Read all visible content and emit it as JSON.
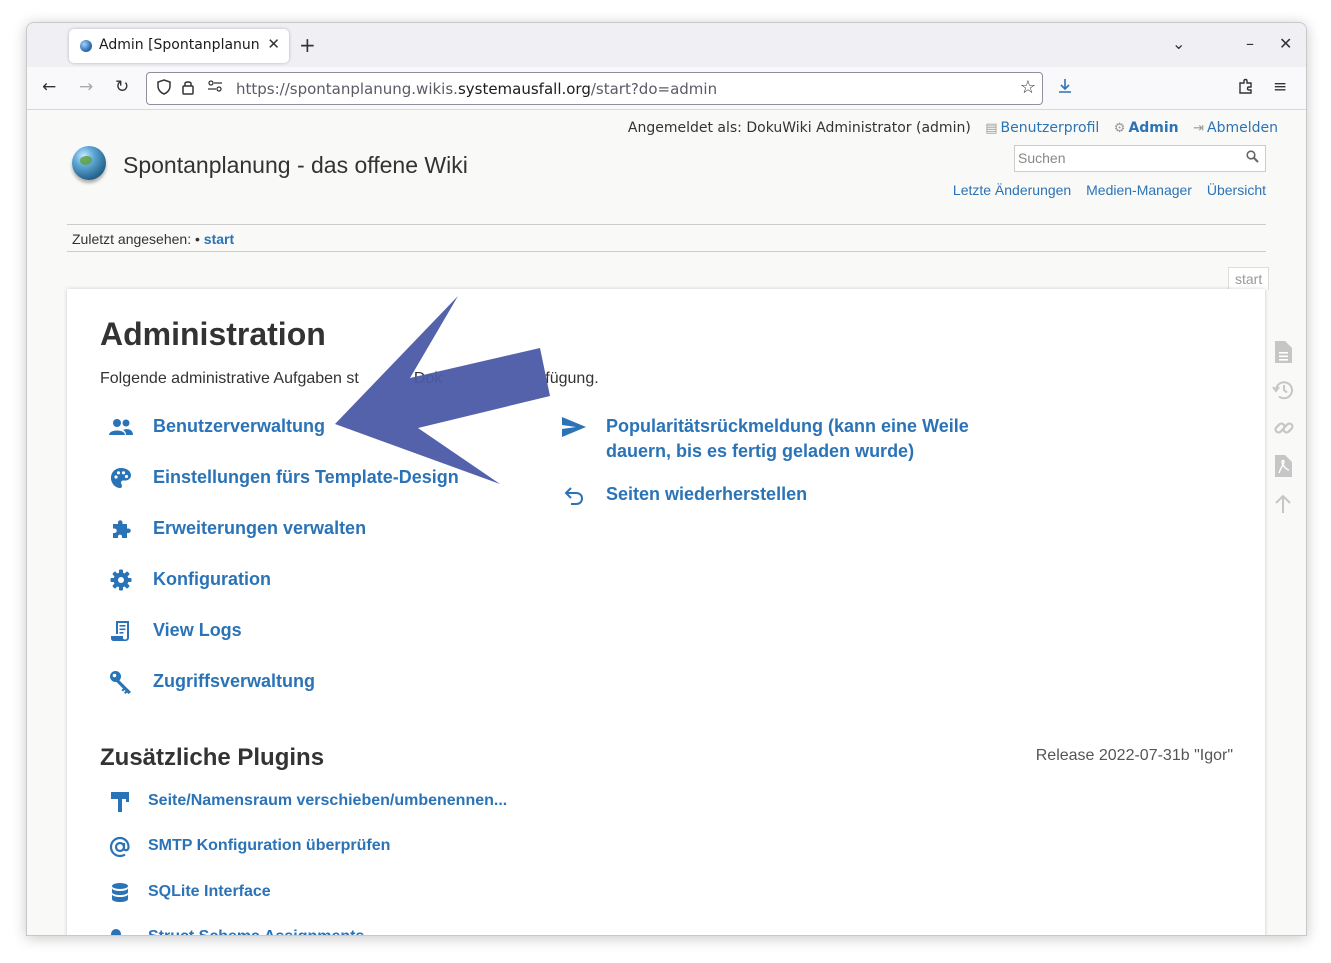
{
  "browser": {
    "tab_title": "Admin [Spontanplanung - das offene Wiki]",
    "url_prefix": "https://spontanplanung.wikis.",
    "url_host": "systemausfall.org",
    "url_path": "/start?do=admin"
  },
  "header": {
    "logged_in": "Angemeldet als: DokuWiki Administrator (admin)",
    "user_links": [
      "Benutzerprofil",
      "Admin",
      "Abmelden"
    ],
    "site_title": "Spontanplanung - das offene Wiki",
    "search_placeholder": "Suchen",
    "site_tools": [
      "Letzte Änderungen",
      "Medien-Manager",
      "Übersicht"
    ]
  },
  "breadcrumb": {
    "label": "Zuletzt angesehen:",
    "separator": "•",
    "item": "start"
  },
  "page_id": "start",
  "main": {
    "title": "Administration",
    "intro_left": "Folgende administrative Aufgaben st",
    "intro_mid": "Dok",
    "intro_right": "fügung.",
    "admin_left": [
      {
        "label": "Benutzerverwaltung",
        "icon": "users-icon"
      },
      {
        "label": "Einstellungen fürs Template-Design",
        "icon": "palette-icon"
      },
      {
        "label": "Erweiterungen verwalten",
        "icon": "puzzle-icon"
      },
      {
        "label": "Konfiguration",
        "icon": "gear-icon"
      },
      {
        "label": "View Logs",
        "icon": "log-icon"
      },
      {
        "label": "Zugriffsverwaltung",
        "icon": "key-icon"
      }
    ],
    "admin_right": [
      {
        "label": "Popularitätsrückmeldung (kann eine Weile dauern, bis es fertig geladen wurde)",
        "icon": "send-icon"
      },
      {
        "label": "Seiten wiederherstellen",
        "icon": "undo-icon"
      }
    ],
    "plugins_title": "Zusätzliche Plugins",
    "release": "Release 2022-07-31b \"Igor\"",
    "plugins": [
      {
        "label": "Seite/Namensraum verschieben/umbenennen...",
        "icon": "move-icon"
      },
      {
        "label": "SMTP Konfiguration überprüfen",
        "icon": "at-icon"
      },
      {
        "label": "SQLite Interface",
        "icon": "database-icon"
      },
      {
        "label": "Struct Schema Assignments",
        "icon": "struct-icon"
      }
    ]
  },
  "colors": {
    "link": "#2b73b7",
    "arrow": "#4b58a6",
    "text": "#333333"
  }
}
